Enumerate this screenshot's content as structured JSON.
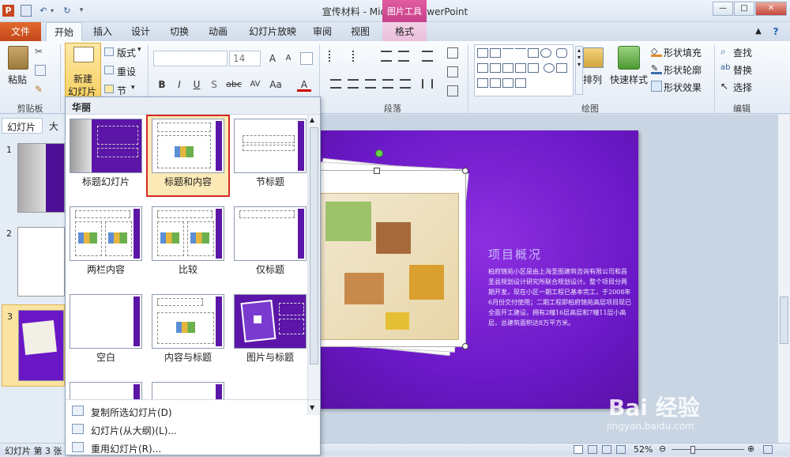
{
  "window": {
    "title": "宣传材料 - Microsoft PowerPoint",
    "context_tab_group": "图片工具",
    "ppt_badge": "P"
  },
  "tabs": [
    "文件",
    "开始",
    "插入",
    "设计",
    "切换",
    "动画",
    "幻灯片放映",
    "审阅",
    "视图",
    "格式"
  ],
  "ribbon": {
    "clipboard": {
      "paste": "粘贴",
      "label": "剪贴板"
    },
    "slides": {
      "new_slide_line1": "新建",
      "new_slide_line2": "幻灯片",
      "layout": "版式",
      "reset": "重设",
      "section": "节"
    },
    "font": {
      "size": "14",
      "bold": "B",
      "italic": "I",
      "underline": "U",
      "shadow": "S",
      "strike": "abc",
      "spacing": "AV",
      "case": "Aa",
      "color": "A",
      "grow": "A",
      "shrink": "A"
    },
    "paragraph": {
      "label": "段落"
    },
    "drawing": {
      "arrange": "排列",
      "quick_styles": "快速样式",
      "shape_fill": "形状填充",
      "shape_outline": "形状轮廓",
      "shape_effects": "形状效果",
      "label": "绘图"
    },
    "editing": {
      "find": "查找",
      "replace": "替换",
      "select": "选择",
      "label": "编辑"
    }
  },
  "pane": {
    "tab_slides": "幻灯片",
    "tab_outline": "大",
    "slide_numbers": [
      "1",
      "2",
      "3"
    ]
  },
  "dropdown": {
    "header": "华丽",
    "layouts": [
      {
        "label": "标题幻灯片",
        "selected": false
      },
      {
        "label": "标题和内容",
        "selected": true
      },
      {
        "label": "节标题",
        "selected": false
      },
      {
        "label": "两栏内容",
        "selected": false
      },
      {
        "label": "比较",
        "selected": false
      },
      {
        "label": "仅标题",
        "selected": false
      },
      {
        "label": "空白",
        "selected": false
      },
      {
        "label": "内容与标题",
        "selected": false
      },
      {
        "label": "图片与标题",
        "selected": false
      }
    ],
    "menu": [
      "复制所选幻灯片(D)",
      "幻灯片(从大纲)(L)...",
      "重用幻灯片(R)..."
    ]
  },
  "slide": {
    "heading": "项目概况",
    "body": "柏府锦苑小区是由上海圣图建筑咨询有限公司和昌圣县规划设计研究所联合规划设计。整个项目分两期开发，现在小区一期工程已基本完工，于2008年6月份交付使用；二期工程即柏府锦苑高层项目现已全面开工建设，拥有2幢16层高层和7幢11层小高层，总建筑面积达8万平方米。"
  },
  "status": {
    "left": "幻灯片 第 3 张",
    "zoom": "52%"
  },
  "watermark": {
    "brand": "Bai  经验",
    "url": "jingyan.baidu.com"
  },
  "colors": {
    "accent_file": "#d0501f",
    "selected_outline": "#d72b22",
    "slide_purple": "#6a18c6",
    "context_pink": "#c8418b"
  }
}
